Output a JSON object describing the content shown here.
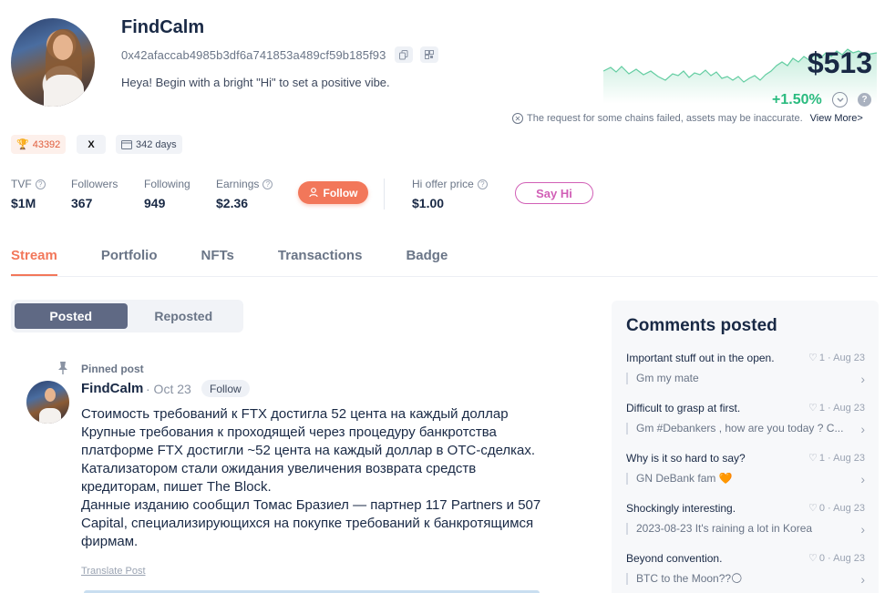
{
  "profile": {
    "name": "FindCalm",
    "address": "0x42afaccab4985b3df6a741853a489cf59b185f93",
    "bio": "Heya! Begin with a bright \"Hi\" to set a positive vibe.",
    "balance": "$513",
    "change": "+1.50%",
    "warning": "The request for some chains failed, assets may be inaccurate.",
    "warning_link": "View More>"
  },
  "chips": {
    "score": "43392",
    "x": "X",
    "days": "342 days"
  },
  "stats": [
    {
      "label": "TVF",
      "value": "$1M"
    },
    {
      "label": "Followers",
      "value": "367"
    },
    {
      "label": "Following",
      "value": "949"
    },
    {
      "label": "Earnings",
      "value": "$2.36"
    }
  ],
  "follow_label": "Follow",
  "offer": {
    "label": "Hi offer price",
    "value": "$1.00"
  },
  "sayhi_label": "Say Hi",
  "tabs": [
    "Stream",
    "Portfolio",
    "NFTs",
    "Transactions",
    "Badge"
  ],
  "segment": [
    "Posted",
    "Reposted"
  ],
  "post": {
    "pinned": "Pinned post",
    "name": "FindCalm",
    "date": "· Oct 23",
    "follow": "Follow",
    "lines": [
      "Стоимость требований к FTX достигла 52 цента на каждый доллар",
      "Крупные требования к проходящей через процедуру банкротства",
      "платформе FTX достигли ~52 цента на каждый доллар в OTC-сделках.",
      "Катализатором стали ожидания увеличения возврата средств",
      "кредиторам, пишет The Block.",
      "Данные изданию сообщил Томас Бразиел — партнер 117 Partners и 507",
      "Capital, специализирующихся на покупке требований к банкротящимся",
      "фирмам."
    ],
    "translate": "Translate Post"
  },
  "comments": {
    "title": "Comments posted",
    "items": [
      {
        "title": "Important stuff out in the open.",
        "meta": "1 · Aug 23",
        "reply": "Gm my mate"
      },
      {
        "title": "Difficult to grasp at first.",
        "meta": "1 · Aug 23",
        "reply": "Gm #Debankers , how are you today ? C..."
      },
      {
        "title": "Why is it so hard to say?",
        "meta": "1 · Aug 23",
        "reply": "GN DeBank fam 🧡"
      },
      {
        "title": "Shockingly interesting.",
        "meta": "0 · Aug 23",
        "reply": "2023-08-23 It's raining a lot in Korea"
      },
      {
        "title": "Beyond convention.",
        "meta": "0 · Aug 23",
        "reply": "BTC to the Moon??🌕"
      }
    ]
  },
  "colors": {
    "accent": "#f2775a",
    "positive": "#2abb7f",
    "sayhi": "#d15fb6"
  },
  "icons": [
    "copy-icon",
    "qr-icon",
    "trophy-icon",
    "x-logo-icon",
    "calendar-icon",
    "user-plus-icon",
    "pin-icon",
    "heart-icon",
    "chevron-right-icon",
    "chevron-down-icon",
    "help-icon",
    "close-circle-icon"
  ]
}
